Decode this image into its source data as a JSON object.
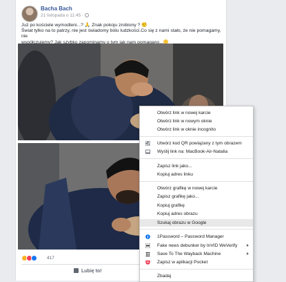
{
  "post": {
    "author": "Bacha Bach",
    "date": "21 listopada o 11:45 ·",
    "text_line1": "Już po kościele wymodleni...? 🙏  Znak pokoju zrobiony ? 🤨",
    "text_line2": "Świat tylko na to patrzy, nie jest świadomy bólu ludzkości.Co się z nami stało, że nie pomagamy, nie",
    "text_line3": "współczujemy? Jak szybko zapominamy o tym jak nam pomagano...",
    "reaction_count": "417",
    "like_label": "Lubię to!"
  },
  "context_menu": {
    "items": [
      {
        "label": "Otwórz link w nowej karcie"
      },
      {
        "label": "Otwórz link w nowym oknie"
      },
      {
        "label": "Otwórz link w oknie incognito"
      },
      {
        "label": "Utwórz kod QR powiązany z tym obrazem",
        "icon": "qr-code-icon"
      },
      {
        "label": "Wyślij link na: MacBook-Air-Natalia",
        "icon": "devices-icon"
      },
      {
        "label": "Zapisz link jako..."
      },
      {
        "label": "Kopiuj adres linku"
      },
      {
        "label": "Otwórz grafikę w nowej karcie"
      },
      {
        "label": "Zapisz grafikę jako..."
      },
      {
        "label": "Kopiuj grafikę"
      },
      {
        "label": "Kopiuj adres obrazu"
      },
      {
        "label": "Szukaj obrazu w Google"
      },
      {
        "label": "1Password – Password Manager",
        "icon": "onepassword-icon"
      },
      {
        "label": "Fake news debunker by InVID  WeVerify",
        "icon": "invid-icon"
      },
      {
        "label": "Save To The Wayback Machine",
        "icon": "wayback-icon"
      },
      {
        "label": "Zapisz w aplikacji Pocket",
        "icon": "pocket-icon"
      },
      {
        "label": "Zbadaj"
      }
    ]
  },
  "colors": {
    "facebook_link": "#385898",
    "menu_highlight": "#e8e8e8",
    "pocket": "#ef4056",
    "onepassword": "#0572ec"
  }
}
